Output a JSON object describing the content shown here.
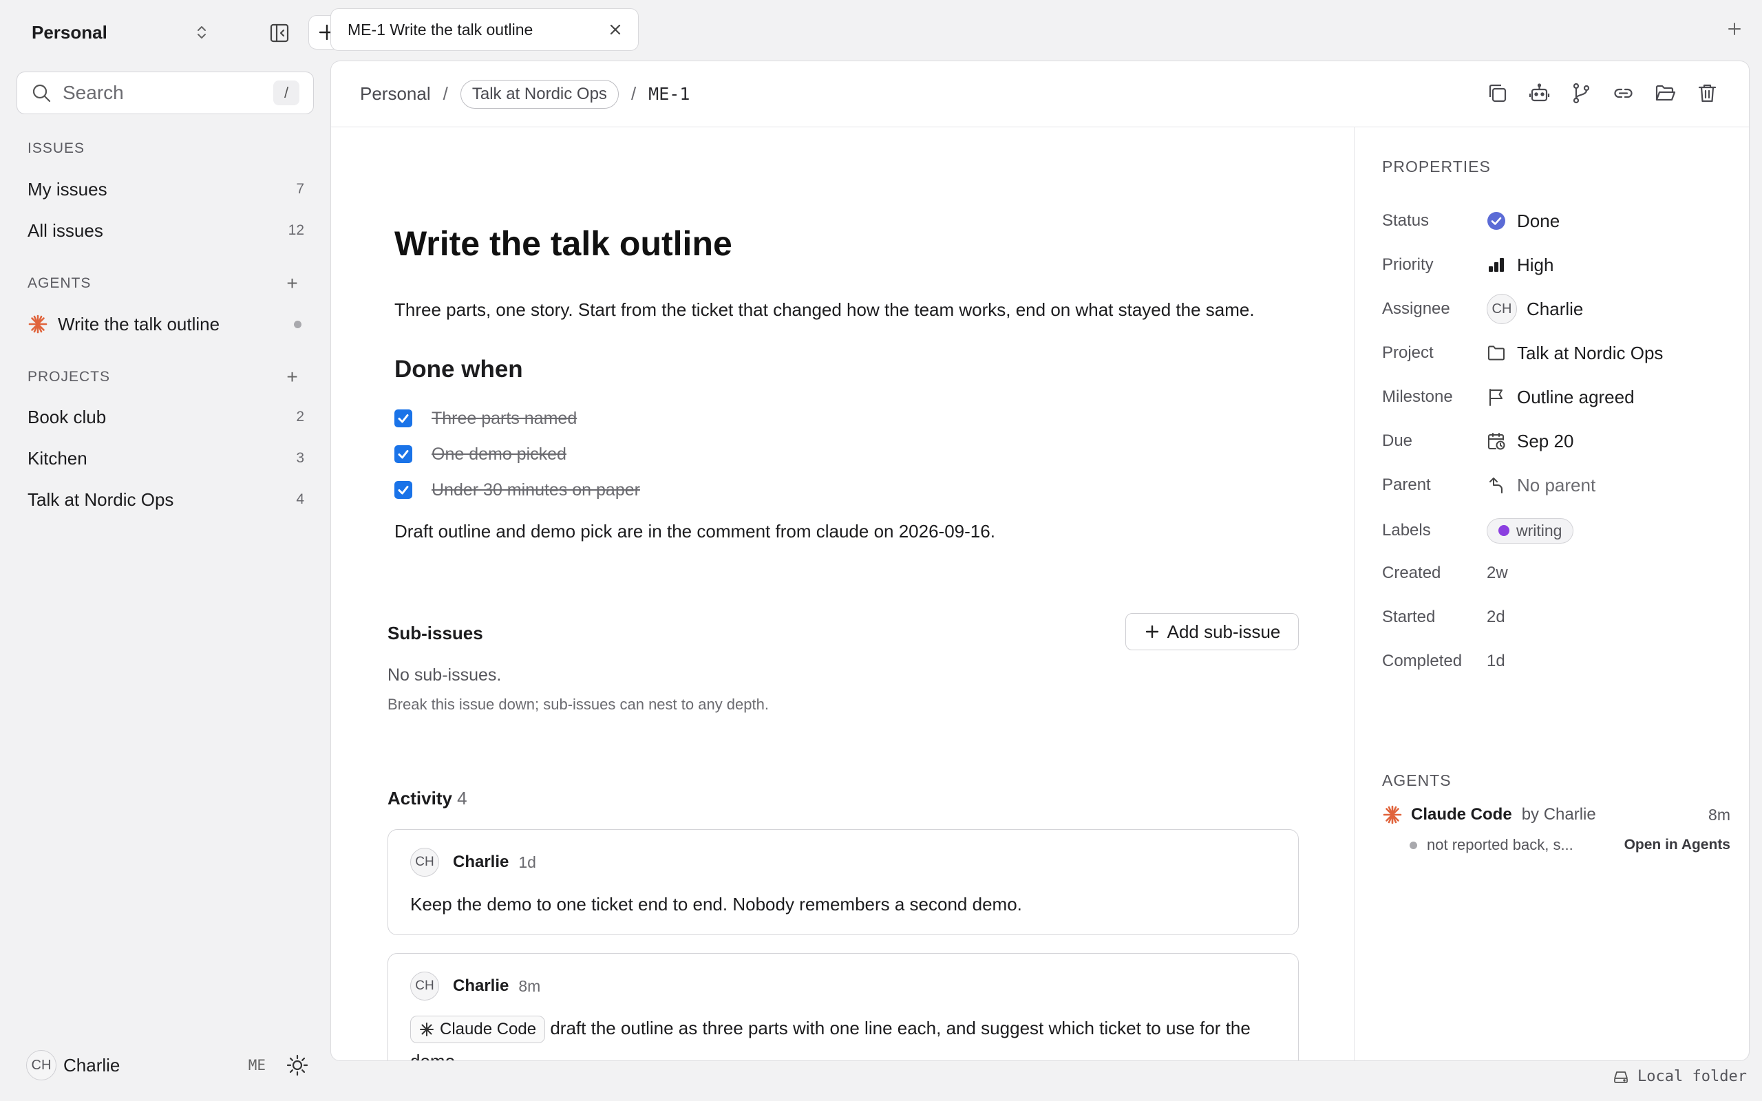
{
  "sidebar": {
    "workspace": "Personal",
    "search": {
      "placeholder": "Search",
      "shortcut": "/"
    },
    "issues": {
      "heading": "ISSUES",
      "items": [
        {
          "label": "My issues",
          "count": "7"
        },
        {
          "label": "All issues",
          "count": "12"
        }
      ]
    },
    "agents": {
      "heading": "AGENTS",
      "add": "+",
      "items": [
        {
          "label": "Write the talk outline",
          "icon": "asterisk-icon"
        }
      ]
    },
    "projects": {
      "heading": "PROJECTS",
      "add": "+",
      "items": [
        {
          "label": "Book club",
          "count": "2"
        },
        {
          "label": "Kitchen",
          "count": "3"
        },
        {
          "label": "Talk at Nordic Ops",
          "count": "4"
        }
      ]
    },
    "user": {
      "initials": "CH",
      "name": "Charlie",
      "code": "ME"
    }
  },
  "tabs": [
    {
      "title": "ME-1 Write the talk outline"
    }
  ],
  "tab_add": "+",
  "breadcrumb": {
    "workspace": "Personal",
    "sep": "/",
    "project": "Talk at Nordic Ops",
    "id": "ME-1"
  },
  "toolbar": {
    "icons": [
      "copy-icon",
      "robot-icon",
      "branch-icon",
      "link-icon",
      "folder-open-icon",
      "trash-icon"
    ]
  },
  "issue": {
    "title": "Write the talk outline",
    "description": "Three parts, one story. Start from the ticket that changed how the team works, end on what stayed the same.",
    "done_when_heading": "Done when",
    "checklist": [
      {
        "label": "Three parts named",
        "checked": true
      },
      {
        "label": "One demo picked",
        "checked": true
      },
      {
        "label": "Under 30 minutes on paper",
        "checked": true
      }
    ],
    "note": "Draft outline and demo pick are in the comment from claude on 2026-09-16."
  },
  "subissues": {
    "heading": "Sub-issues",
    "add_label": "Add sub-issue",
    "empty": "No sub-issues.",
    "hint": "Break this issue down; sub-issues can nest to any depth."
  },
  "activity": {
    "heading": "Activity",
    "count": "4",
    "comments": [
      {
        "initials": "CH",
        "author": "Charlie",
        "time": "1d",
        "body": "Keep the demo to one ticket end to end. Nobody remembers a second demo."
      },
      {
        "initials": "CH",
        "author": "Charlie",
        "time": "8m",
        "mention": "Claude Code",
        "body": "draft the outline as three parts with one line each, and suggest which ticket to use for the demo."
      }
    ]
  },
  "properties": {
    "heading": "PROPERTIES",
    "status": {
      "label": "Status",
      "value": "Done",
      "color": "#5b6bd6"
    },
    "priority": {
      "label": "Priority",
      "value": "High"
    },
    "assignee": {
      "label": "Assignee",
      "initials": "CH",
      "value": "Charlie"
    },
    "project": {
      "label": "Project",
      "value": "Talk at Nordic Ops"
    },
    "milestone": {
      "label": "Milestone",
      "value": "Outline agreed"
    },
    "due": {
      "label": "Due",
      "value": "Sep 20"
    },
    "parent": {
      "label": "Parent",
      "value": "No parent"
    },
    "labels": {
      "label": "Labels",
      "value": "writing",
      "color": "#8b3fe0"
    },
    "created": {
      "label": "Created",
      "value": "2w"
    },
    "started": {
      "label": "Started",
      "value": "2d"
    },
    "completed": {
      "label": "Completed",
      "value": "1d"
    }
  },
  "agents_panel": {
    "heading": "AGENTS",
    "name": "Claude Code",
    "by": "by Charlie",
    "age": "8m",
    "status": "not reported back, s...",
    "open": "Open in Agents"
  },
  "footer": {
    "folder": "Local folder"
  },
  "colors": {
    "accent_check": "#1a73e8",
    "agent_orange": "#e0643c"
  }
}
